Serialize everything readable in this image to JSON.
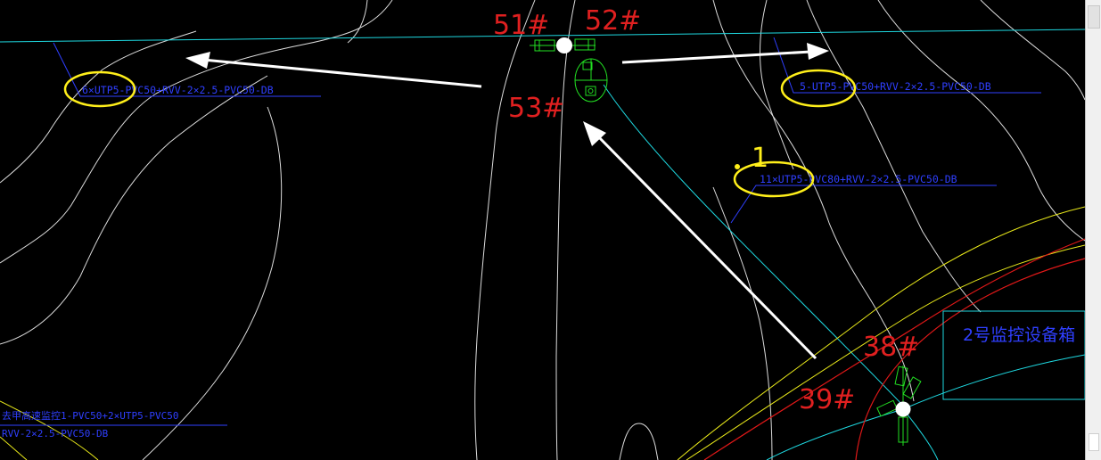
{
  "poles": {
    "p51": "51#",
    "p52": "52#",
    "p53": "53#",
    "p38": "38#",
    "p39": "39#"
  },
  "cables": {
    "left": "6×UTP5-PVC50+RVV-2×2.5-PVC50-DB",
    "right": "5-UTP5-PVC50+RVV-2×2.5-PVC50-DB",
    "middle": "11×UTP5-PVC80+RVV-2×2.5-PVC50-DB",
    "bottom_line1": "去甲高速监控1-PVC50+2×UTP5-PVC50",
    "bottom_line2": "RVV-2×2.5-PVC50-DB"
  },
  "equipment_box": {
    "label": "2号监控设备箱"
  },
  "annotation": {
    "mark": "1"
  },
  "colors": {
    "background": "#000000",
    "contour": "#dcdcdc",
    "road_cyan": "#1ed8e0",
    "pole_label": "#e02020",
    "cable_text": "#2f3fff",
    "highlight": "#ffef1a",
    "equipment": "#22e022",
    "arrow": "#ffffff",
    "road_red": "#e01818",
    "road_yellow": "#e8e81a"
  },
  "icons": [
    "camera-pole-icon",
    "junction-box-icon",
    "arrow-icon"
  ]
}
